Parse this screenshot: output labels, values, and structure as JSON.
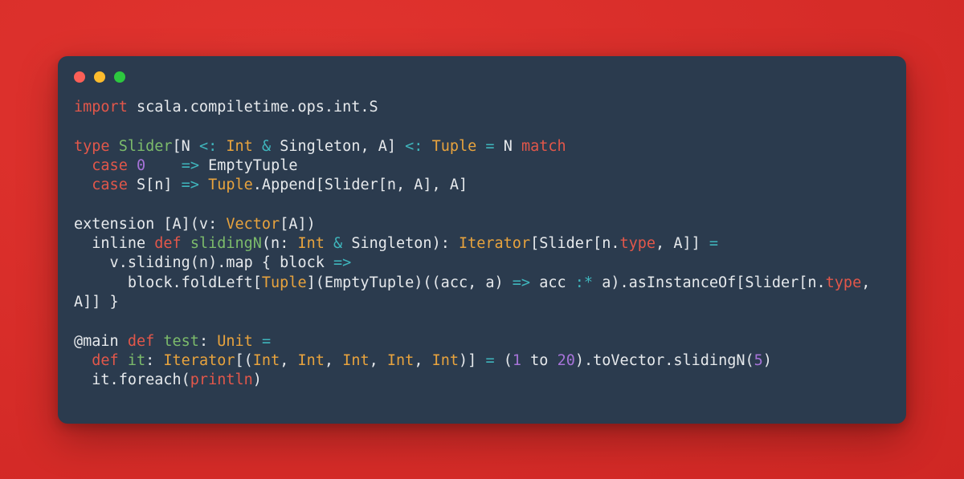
{
  "window": {
    "background_color": "#2b3b4e",
    "page_background_color": "#d92e2a",
    "traffic_lights": [
      {
        "name": "close",
        "color": "#fc5f57"
      },
      {
        "name": "minimize",
        "color": "#fdbc2d"
      },
      {
        "name": "maximize",
        "color": "#2dc83f"
      }
    ]
  },
  "theme": {
    "keyword": "#e2574a",
    "function": "#7cbb6b",
    "type": "#e8a33d",
    "operator": "#3fb6bd",
    "number": "#a673d8",
    "plain": "#e6e9ec"
  },
  "code": {
    "language": "scala",
    "plain_text": "import scala.compiletime.ops.int.S\n\ntype Slider[N <: Int & Singleton, A] <: Tuple = N match\n  case 0    => EmptyTuple\n  case S[n] => Tuple.Append[Slider[n, A], A]\n\nextension [A](v: Vector[A])\n  inline def slidingN(n: Int & Singleton): Iterator[Slider[n.type, A]] =\n    v.sliding(n).map { block =>\n      block.foldLeft[Tuple](EmptyTuple)((acc, a) => acc :* a).asInstanceOf[Slider[n.type, A]] }\n\n@main def test: Unit =\n  def it: Iterator[(Int, Int, Int, Int, Int)] = (1 to 20).toVector.slidingN(5)\n  it.foreach(println)",
    "lines": [
      {
        "id": "l1",
        "tokens": [
          {
            "t": "import",
            "c": "kw"
          },
          {
            "t": " scala.compiletime.ops.int.S",
            "c": "pl"
          }
        ]
      },
      {
        "id": "l2",
        "tokens": []
      },
      {
        "id": "l3",
        "tokens": [
          {
            "t": "type",
            "c": "kw"
          },
          {
            "t": " ",
            "c": "pl"
          },
          {
            "t": "Slider",
            "c": "fn"
          },
          {
            "t": "[N ",
            "c": "pl"
          },
          {
            "t": "<:",
            "c": "op"
          },
          {
            "t": " ",
            "c": "pl"
          },
          {
            "t": "Int",
            "c": "ty"
          },
          {
            "t": " ",
            "c": "pl"
          },
          {
            "t": "&",
            "c": "op"
          },
          {
            "t": " Singleton, A] ",
            "c": "pl"
          },
          {
            "t": "<:",
            "c": "op"
          },
          {
            "t": " ",
            "c": "pl"
          },
          {
            "t": "Tuple",
            "c": "ty"
          },
          {
            "t": " ",
            "c": "pl"
          },
          {
            "t": "=",
            "c": "op"
          },
          {
            "t": " N ",
            "c": "pl"
          },
          {
            "t": "match",
            "c": "kw"
          }
        ]
      },
      {
        "id": "l4",
        "tokens": [
          {
            "t": "  ",
            "c": "pl"
          },
          {
            "t": "case",
            "c": "kw"
          },
          {
            "t": " ",
            "c": "pl"
          },
          {
            "t": "0",
            "c": "num"
          },
          {
            "t": "    ",
            "c": "pl"
          },
          {
            "t": "=>",
            "c": "op"
          },
          {
            "t": " EmptyTuple",
            "c": "pl"
          }
        ]
      },
      {
        "id": "l5",
        "tokens": [
          {
            "t": "  ",
            "c": "pl"
          },
          {
            "t": "case",
            "c": "kw"
          },
          {
            "t": " S[n] ",
            "c": "pl"
          },
          {
            "t": "=>",
            "c": "op"
          },
          {
            "t": " ",
            "c": "pl"
          },
          {
            "t": "Tuple",
            "c": "ty"
          },
          {
            "t": ".Append[Slider[n, A], A]",
            "c": "pl"
          }
        ]
      },
      {
        "id": "l6",
        "tokens": []
      },
      {
        "id": "l7",
        "tokens": [
          {
            "t": "extension [A](v: ",
            "c": "pl"
          },
          {
            "t": "Vector",
            "c": "ty"
          },
          {
            "t": "[A])",
            "c": "pl"
          }
        ]
      },
      {
        "id": "l8",
        "tokens": [
          {
            "t": "  inline ",
            "c": "pl"
          },
          {
            "t": "def",
            "c": "kw"
          },
          {
            "t": " ",
            "c": "pl"
          },
          {
            "t": "slidingN",
            "c": "fn"
          },
          {
            "t": "(n: ",
            "c": "pl"
          },
          {
            "t": "Int",
            "c": "ty"
          },
          {
            "t": " ",
            "c": "pl"
          },
          {
            "t": "&",
            "c": "op"
          },
          {
            "t": " Singleton): ",
            "c": "pl"
          },
          {
            "t": "Iterator",
            "c": "ty"
          },
          {
            "t": "[Slider[n.",
            "c": "pl"
          },
          {
            "t": "type",
            "c": "kw"
          },
          {
            "t": ", A]] ",
            "c": "pl"
          },
          {
            "t": "=",
            "c": "op"
          }
        ]
      },
      {
        "id": "l9",
        "tokens": [
          {
            "t": "    v.sliding(n).map { block ",
            "c": "pl"
          },
          {
            "t": "=>",
            "c": "op"
          }
        ]
      },
      {
        "id": "l10",
        "tokens": [
          {
            "t": "      block.foldLeft[",
            "c": "pl"
          },
          {
            "t": "Tuple",
            "c": "ty"
          },
          {
            "t": "](EmptyTuple)((acc, a) ",
            "c": "pl"
          },
          {
            "t": "=>",
            "c": "op"
          },
          {
            "t": " acc ",
            "c": "pl"
          },
          {
            "t": ":*",
            "c": "op"
          },
          {
            "t": " a).asInstanceOf[Slider[n.",
            "c": "pl"
          },
          {
            "t": "type",
            "c": "kw"
          },
          {
            "t": ",",
            "c": "pl"
          }
        ]
      },
      {
        "id": "l11",
        "tokens": [
          {
            "t": "A]] }",
            "c": "pl"
          }
        ]
      },
      {
        "id": "l12",
        "tokens": []
      },
      {
        "id": "l13",
        "tokens": [
          {
            "t": "@main ",
            "c": "pl"
          },
          {
            "t": "def",
            "c": "kw"
          },
          {
            "t": " ",
            "c": "pl"
          },
          {
            "t": "test",
            "c": "fn"
          },
          {
            "t": ": ",
            "c": "pl"
          },
          {
            "t": "Unit",
            "c": "ty"
          },
          {
            "t": " ",
            "c": "pl"
          },
          {
            "t": "=",
            "c": "op"
          }
        ]
      },
      {
        "id": "l14",
        "tokens": [
          {
            "t": "  ",
            "c": "pl"
          },
          {
            "t": "def",
            "c": "kw"
          },
          {
            "t": " ",
            "c": "pl"
          },
          {
            "t": "it",
            "c": "fn"
          },
          {
            "t": ": ",
            "c": "pl"
          },
          {
            "t": "Iterator",
            "c": "ty"
          },
          {
            "t": "[(",
            "c": "pl"
          },
          {
            "t": "Int",
            "c": "ty"
          },
          {
            "t": ", ",
            "c": "pl"
          },
          {
            "t": "Int",
            "c": "ty"
          },
          {
            "t": ", ",
            "c": "pl"
          },
          {
            "t": "Int",
            "c": "ty"
          },
          {
            "t": ", ",
            "c": "pl"
          },
          {
            "t": "Int",
            "c": "ty"
          },
          {
            "t": ", ",
            "c": "pl"
          },
          {
            "t": "Int",
            "c": "ty"
          },
          {
            "t": ")] ",
            "c": "pl"
          },
          {
            "t": "=",
            "c": "op"
          },
          {
            "t": " (",
            "c": "pl"
          },
          {
            "t": "1",
            "c": "num"
          },
          {
            "t": " to ",
            "c": "pl"
          },
          {
            "t": "20",
            "c": "num"
          },
          {
            "t": ").toVector.slidingN(",
            "c": "pl"
          },
          {
            "t": "5",
            "c": "num"
          },
          {
            "t": ")",
            "c": "pl"
          }
        ]
      },
      {
        "id": "l15",
        "tokens": [
          {
            "t": "  it.foreach(",
            "c": "pl"
          },
          {
            "t": "println",
            "c": "kw"
          },
          {
            "t": ")",
            "c": "pl"
          }
        ]
      }
    ]
  }
}
